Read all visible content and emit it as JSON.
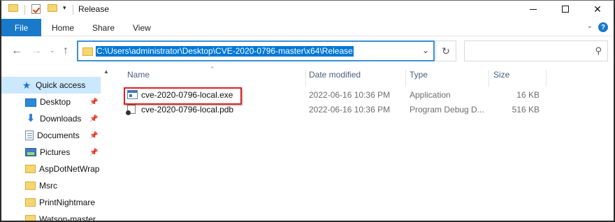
{
  "window": {
    "title": "Release",
    "controls": {
      "minimize": "minimize",
      "maximize": "maximize",
      "close": "✕"
    }
  },
  "quick_access_toolbar": {
    "dropdown": "▾"
  },
  "ribbon": {
    "tabs": [
      "File",
      "Home",
      "Share",
      "View"
    ],
    "expand_chevron": "⌄",
    "help": "?"
  },
  "navigation": {
    "back": "←",
    "forward": "→",
    "recent": "⌄",
    "up": "↑",
    "address": "C:\\Users\\administrator\\Desktop\\CVE-2020-0796-master\\x64\\Release",
    "address_dropdown": "⌄",
    "refresh": "↻",
    "search_placeholder": "",
    "search_icon": "⚲"
  },
  "nav_pane": {
    "scroll_up": "▲",
    "pin_glyph": "📌",
    "items": [
      {
        "label": "Quick access",
        "icon": "star-icon",
        "selected": true,
        "pinned": false
      },
      {
        "label": "Desktop",
        "icon": "desktop-icon",
        "selected": false,
        "pinned": true
      },
      {
        "label": "Downloads",
        "icon": "download-icon",
        "selected": false,
        "pinned": true
      },
      {
        "label": "Documents",
        "icon": "documents-icon",
        "selected": false,
        "pinned": true
      },
      {
        "label": "Pictures",
        "icon": "pictures-icon",
        "selected": false,
        "pinned": true
      },
      {
        "label": "AspDotNetWrap",
        "icon": "folder-icon",
        "selected": false,
        "pinned": false
      },
      {
        "label": "Msrc",
        "icon": "folder-icon",
        "selected": false,
        "pinned": false
      },
      {
        "label": "PrintNightmare",
        "icon": "folder-icon",
        "selected": false,
        "pinned": false
      },
      {
        "label": "Watson-master",
        "icon": "folder-icon",
        "selected": false,
        "pinned": false
      }
    ]
  },
  "file_list": {
    "sort_indicator": "⌃",
    "columns": {
      "name": "Name",
      "date": "Date modified",
      "type": "Type",
      "size": "Size"
    },
    "rows": [
      {
        "name": "cve-2020-0796-local.exe",
        "date": "2022-06-16 10:36 PM",
        "type": "Application",
        "size": "16 KB",
        "icon": "exe-icon",
        "highlighted": true
      },
      {
        "name": "cve-2020-0796-local.pdb",
        "date": "2022-06-16 10:36 PM",
        "type": "Program Debug D...",
        "size": "516 KB",
        "icon": "pdb-icon",
        "highlighted": false
      }
    ]
  },
  "colors": {
    "accent": "#1979ca",
    "selection": "#cce8ff",
    "address_highlight": "#0078d7",
    "annotation": "#e02020"
  }
}
